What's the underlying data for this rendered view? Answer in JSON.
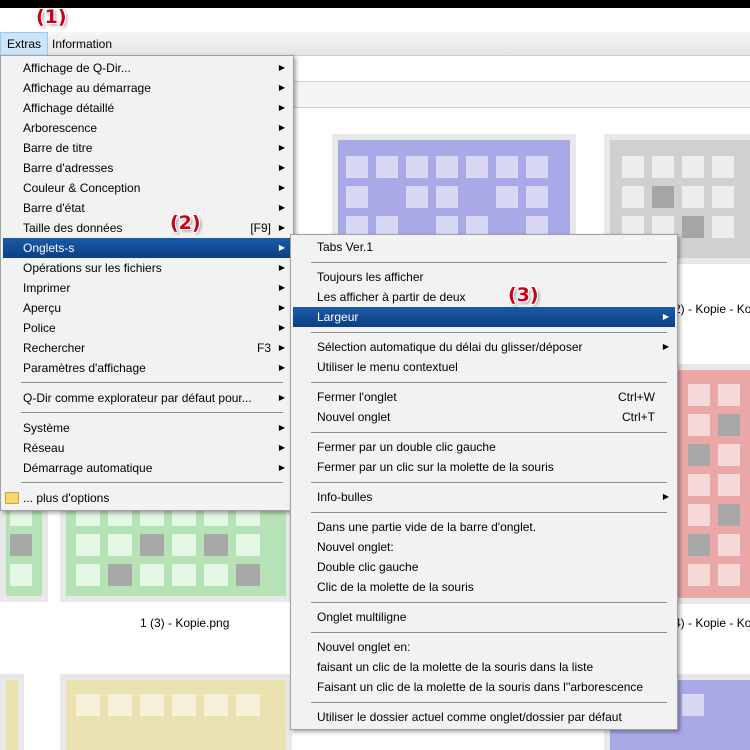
{
  "menubar": {
    "extras": "Extras",
    "information": "Information"
  },
  "annotations": {
    "a1": "(1)",
    "a2": "(2)",
    "a3": "(3)"
  },
  "captions": {
    "c1": "1 (3) - Kopie.png",
    "c2": "2) - Kopie - Ko",
    "c3": "4) - Kopie - Ko"
  },
  "extras_menu": {
    "items": [
      {
        "label": "Affichage de Q-Dir...",
        "submenu": true
      },
      {
        "label": "Affichage au démarrage",
        "submenu": true
      },
      {
        "label": "Affichage détaillé",
        "submenu": true
      },
      {
        "label": "Arborescence",
        "submenu": true
      },
      {
        "label": "Barre de titre",
        "submenu": true
      },
      {
        "label": "Barre d'adresses",
        "submenu": true
      },
      {
        "label": "Couleur & Conception",
        "submenu": true
      },
      {
        "label": "Barre d'état",
        "submenu": true
      },
      {
        "label": "Taille des données",
        "shortcut": "[F9]",
        "submenu": true
      },
      {
        "label": "Onglets-s",
        "submenu": true,
        "highlighted": true
      },
      {
        "label": "Opérations sur les fichiers",
        "submenu": true
      },
      {
        "label": "Imprimer",
        "submenu": true
      },
      {
        "label": "Aperçu",
        "submenu": true
      },
      {
        "label": "Police",
        "submenu": true
      },
      {
        "label": "Rechercher",
        "shortcut": "F3",
        "submenu": true
      },
      {
        "label": "Paramètres d'affichage",
        "submenu": true
      },
      {
        "label": "Q-Dir comme explorateur par défaut pour...",
        "submenu": true
      },
      {
        "label": "Système",
        "submenu": true
      },
      {
        "label": "Réseau",
        "submenu": true
      },
      {
        "label": "Démarrage automatique",
        "submenu": true
      },
      {
        "label": "... plus d'options",
        "icon": "folder-icon"
      }
    ]
  },
  "tabs_submenu": {
    "items": [
      {
        "label": "Tabs Ver.1"
      },
      {
        "label": "Toujours les afficher"
      },
      {
        "label": "Les afficher à partir de deux"
      },
      {
        "label": "Largeur",
        "submenu": true,
        "highlighted": true
      },
      {
        "label": "Sélection automatique du délai du glisser/déposer",
        "submenu": true
      },
      {
        "label": "Utiliser le menu contextuel"
      },
      {
        "label": "Fermer l'onglet",
        "shortcut": "Ctrl+W"
      },
      {
        "label": "Nouvel onglet",
        "shortcut": "Ctrl+T"
      },
      {
        "label": "Fermer par un double clic gauche"
      },
      {
        "label": "Fermer par un clic sur la molette de la souris"
      },
      {
        "label": "Info-bulles",
        "submenu": true
      },
      {
        "label": "Dans une partie vide de la barre d'onglet."
      },
      {
        "label": "Nouvel onglet:"
      },
      {
        "label": "Double clic gauche"
      },
      {
        "label": "Clic de la molette de la souris"
      },
      {
        "label": "Onglet multiligne"
      },
      {
        "label": "Nouvel onglet en:"
      },
      {
        "label": "faisant un clic de la molette de la souris dans la liste"
      },
      {
        "label": "Faisant un clic de la molette de la souris dans l''arborescence"
      },
      {
        "label": "Utiliser le dossier actuel comme onglet/dossier par défaut"
      }
    ]
  },
  "colors": {
    "highlight": "#0b3f84",
    "annotation": "#c8001a"
  }
}
